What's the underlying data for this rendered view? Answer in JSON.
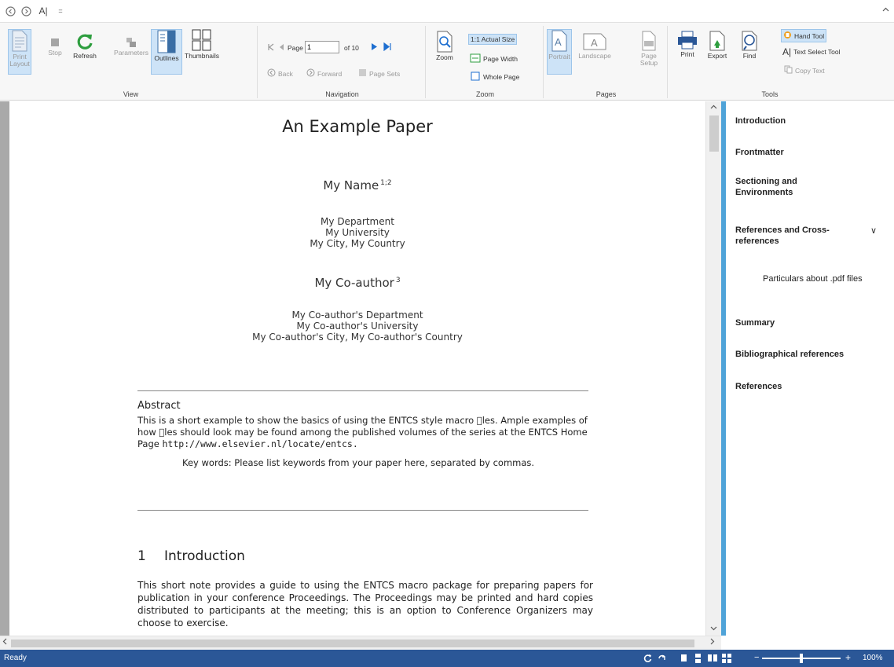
{
  "quick_access": {
    "icons": [
      "back-circle-icon",
      "forward-circle-icon",
      "text-select-icon",
      "customize-icon"
    ],
    "text_select_glyph": "A|",
    "customize_glyph": "="
  },
  "ribbon": {
    "view": {
      "label": "View",
      "print_layout": "Print Layout",
      "stop": "Stop",
      "refresh": "Refresh",
      "parameters": "Parameters",
      "outlines": "Outlines",
      "thumbnails": "Thumbnails"
    },
    "navigation": {
      "label": "Navigation",
      "page_label": "Page",
      "page_value": "1",
      "of_pages": "of 10",
      "back": "Back",
      "forward": "Forward",
      "page_sets": "Page Sets"
    },
    "zoom": {
      "label": "Zoom",
      "zoom": "Zoom",
      "actual_size": "1:1 Actual Size",
      "page_width": "Page Width",
      "whole_page": "Whole Page"
    },
    "pages": {
      "label": "Pages",
      "portrait": "Portrait",
      "landscape": "Landscape",
      "page_setup": "Page Setup"
    },
    "tools": {
      "label": "Tools",
      "print": "Print",
      "export": "Export",
      "find": "Find",
      "hand_tool": "Hand Tool",
      "text_select_tool": "Text Select Tool",
      "copy_text": "Copy Text"
    }
  },
  "document": {
    "title": "An Example Paper",
    "author1": "My Name",
    "author1_sup": "1;2",
    "aff1": [
      "My Department",
      "My University",
      "My City, My Country"
    ],
    "author2": "My Co-author",
    "author2_sup": "3",
    "aff2": [
      "My Co-author's Department",
      "My Co-author's University",
      "My Co-author's City, My Co-author's Country"
    ],
    "abstract_heading": "Abstract",
    "abstract_text": "This is a short example to show the basics of using the ENTCS style macro \u0000les. Ample examples of how \u0000les should look may be found among the published volumes of the series at the ENTCS Home Page ",
    "abstract_url": "http://www.elsevier.nl/locate/entcs.",
    "keywords": "Key words:  Please list keywords from your paper here, separated by commas.",
    "section_number": "1",
    "section_title": "Introduction",
    "section_text": "This short note provides a guide to using the ENTCS macro package for preparing papers for publication in your conference Proceedings. The Proceedings may be printed and hard copies distributed to participants at the meeting; this is an option to Conference Organizers may choose to exercise."
  },
  "outline": {
    "items": [
      "Introduction",
      "Frontmatter",
      "Sectioning and Environments",
      "References and Cross-references",
      "Particulars about .pdf files",
      "Summary",
      "Bibliographical references",
      "References"
    ],
    "expand_glyph": "∨"
  },
  "status_bar": {
    "status": "Ready",
    "zoom_percent": "100%",
    "zoom_level": 0.5
  },
  "colors": {
    "status_bar": "#2b5797",
    "outline_accent": "#4fa3d8",
    "selected_button": "#cde3f7",
    "refresh_icon": "#2e9e3f",
    "nav_arrow": "#1e6fd0"
  }
}
